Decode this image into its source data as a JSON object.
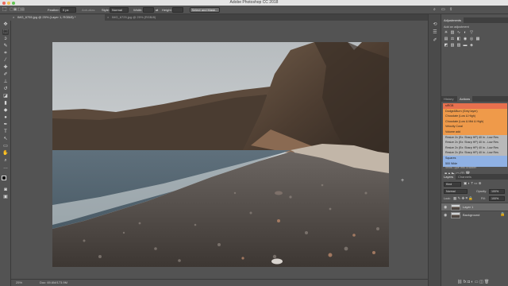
{
  "window": {
    "title": "Adobe Photoshop CC 2018"
  },
  "options_bar": {
    "feather_label": "Feather:",
    "feather_value": "0 px",
    "antialias_label": "Anti-alias",
    "style_label": "Style:",
    "style_value": "Normal",
    "width_label": "Width:",
    "height_label": "Height:",
    "select_mask_label": "Select and Mask..."
  },
  "document_tabs": [
    {
      "label": "IMG_6755.jpg @ 25% (Layer 1, RGB/8) *",
      "active": true
    },
    {
      "label": "IMG_6725.jpg @ 25% (RGB/8)",
      "active": false
    }
  ],
  "status_bar": {
    "zoom": "25%",
    "doc": "Doc: 69.6M/173.9M"
  },
  "adjustments": {
    "tab": "Adjustments",
    "hint": "Add an adjustment"
  },
  "history_actions": {
    "tabs": [
      "History",
      "Actions"
    ],
    "active_tab": "Actions",
    "rows": [
      {
        "label": "siRGB",
        "color": "#e8704e"
      },
      {
        "label": "Dodge&Burn (Grey layer)",
        "color": "#ef9a4a"
      },
      {
        "label": "Chocolate (Low & High)",
        "color": "#ef9a4a"
      },
      {
        "label": "Chocolate (Low & Mid & High)",
        "color": "#ef9a4a"
      },
      {
        "label": "Velocity Coral",
        "color": "#ef9a4a"
      },
      {
        "label": "Volume add",
        "color": "#ef9a4a"
      },
      {
        "label": "Resize 2x (Ex: Sharp HP) 40 in - Low Res",
        "color": "#b9b9b9"
      },
      {
        "label": "Resize 2x (Ex: Sharp HP) 40 in - Low Res",
        "color": "#b9b9b9"
      },
      {
        "label": "Resize 2x (Ex: Sharp HP) 40 in - Low Res",
        "color": "#b9b9b9"
      },
      {
        "label": "Resize 2x (Ex: Sharp HP) 40 in - Low Res",
        "color": "#b9b9b9"
      },
      {
        "label": "Squares",
        "color": "#8fb1e4"
      },
      {
        "label": "500 Wide",
        "color": "#8fb1e4"
      }
    ],
    "footer": "Show Type Info Grabber"
  },
  "layers_panel": {
    "tabs": [
      "Layers",
      "Channels"
    ],
    "active_tab": "Layers",
    "filter_label": "Kind",
    "blend_mode": "Normal",
    "opacity_label": "Opacity:",
    "opacity_value": "100%",
    "lock_label": "Lock:",
    "fill_label": "Fill:",
    "fill_value": "100%",
    "layers": [
      {
        "name": "Layer 1",
        "selected": true
      },
      {
        "name": "Background",
        "selected": false
      }
    ]
  }
}
